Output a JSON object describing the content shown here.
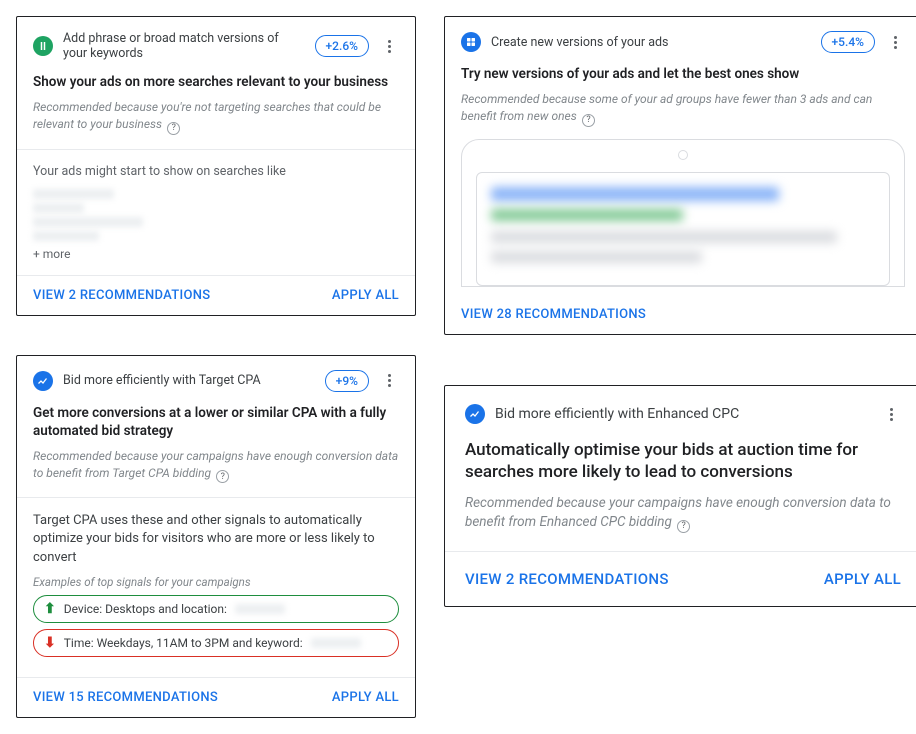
{
  "cards": {
    "card1": {
      "title": "Add phrase or broad match versions of your keywords",
      "uplift": "+2.6%",
      "headline": "Show your ads on more searches relevant to your business",
      "reason": "Recommended because you're not targeting searches that could be relevant to your business",
      "body_intro": "Your ads might start to show on searches like",
      "more": "+ more",
      "view": "VIEW 2 RECOMMENDATIONS",
      "apply": "APPLY ALL"
    },
    "card2": {
      "title": "Create new versions of your ads",
      "uplift": "+5.4%",
      "headline": "Try new versions of your ads and let the best ones show",
      "reason": "Recommended because some of your ad groups have fewer than 3 ads and can benefit from new ones",
      "view": "VIEW 28 RECOMMENDATIONS"
    },
    "card3": {
      "title": "Bid more efficiently with Target CPA",
      "uplift": "+9%",
      "headline": "Get more conversions at a lower or similar CPA with a fully automated bid strategy",
      "reason": "Recommended because your campaigns have enough conversion data to benefit from Target CPA bidding",
      "body_intro": "Target CPA uses these and other signals to automatically optimize your bids for visitors who are more or less likely to convert",
      "signals_caption": "Examples of top signals for your campaigns",
      "signal_up": "Device: Desktops and location:",
      "signal_dn": "Time: Weekdays, 11AM to 3PM and keyword:",
      "view": "VIEW 15 RECOMMENDATIONS",
      "apply": "APPLY ALL"
    },
    "card4": {
      "title": "Bid more efficiently with Enhanced CPC",
      "headline": "Automatically optimise your bids at auction time for searches more likely to lead to conversions",
      "reason": "Recommended because your campaigns have enough conversion data to benefit from Enhanced CPC bidding",
      "view": "VIEW 2 RECOMMENDATIONS",
      "apply": "APPLY ALL"
    }
  }
}
